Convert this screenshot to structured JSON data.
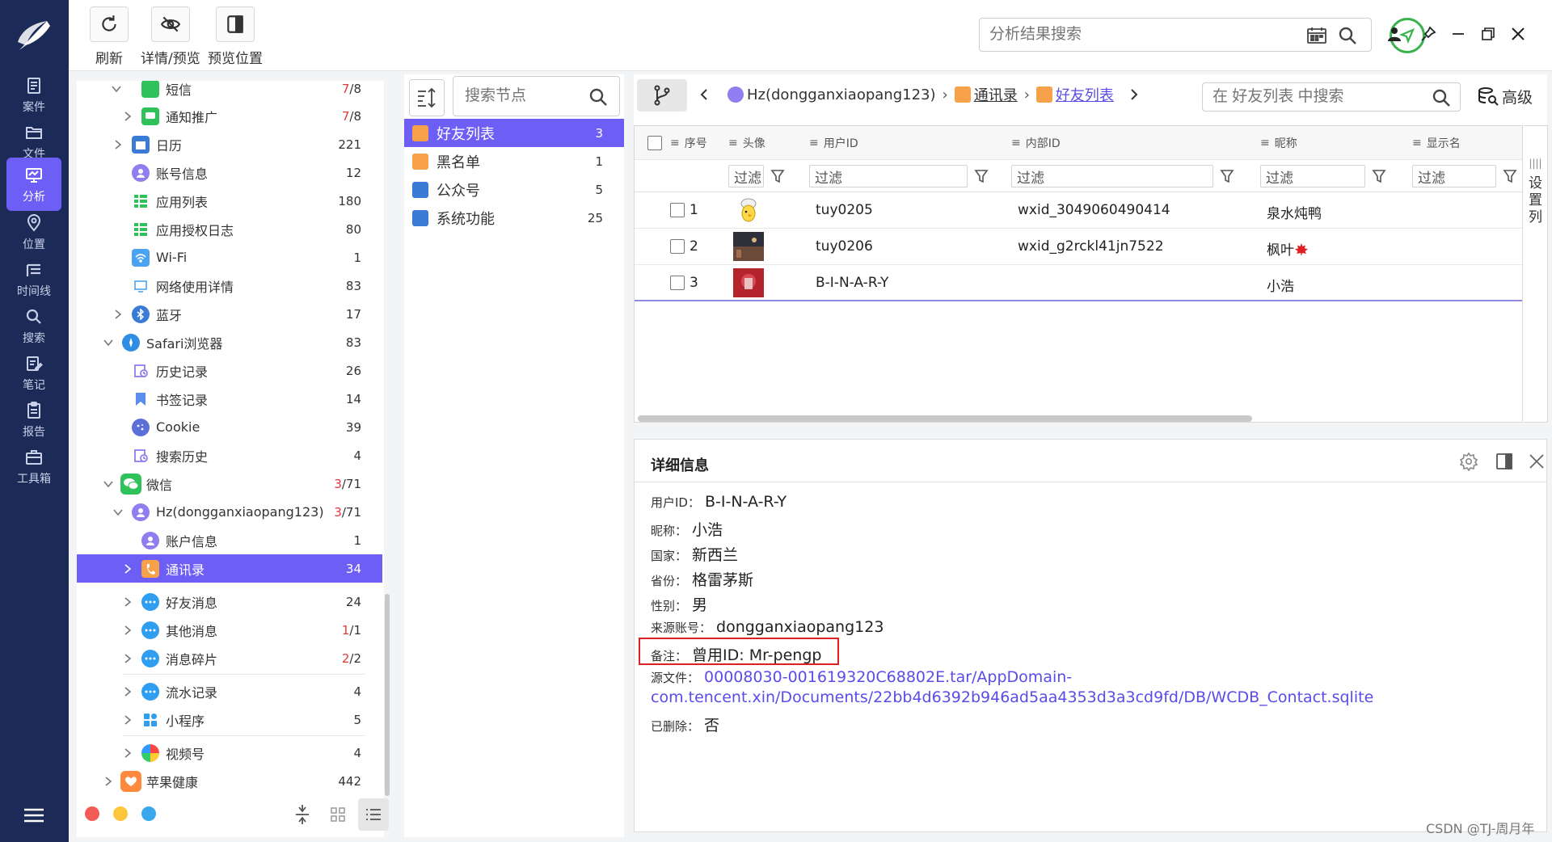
{
  "rail": {
    "items": [
      {
        "label": "案件",
        "icon": "case-icon"
      },
      {
        "label": "文件",
        "icon": "folder-icon"
      },
      {
        "label": "分析",
        "icon": "analysis-icon",
        "active": true
      },
      {
        "label": "位置",
        "icon": "location-icon"
      },
      {
        "label": "时间线",
        "icon": "timeline-icon"
      },
      {
        "label": "搜索",
        "icon": "search-icon"
      },
      {
        "label": "笔记",
        "icon": "note-icon"
      },
      {
        "label": "报告",
        "icon": "report-icon"
      },
      {
        "label": "工具箱",
        "icon": "toolbox-icon"
      }
    ]
  },
  "toolbar": {
    "refresh": "刷新",
    "detail_preview": "详情/预览",
    "preview_position": "预览位置",
    "search_placeholder": "分析结果搜索"
  },
  "tree": {
    "rows": [
      {
        "label": "短信",
        "count_red": "7",
        "count": "/8"
      },
      {
        "label": "通知推广",
        "count_red": "7",
        "count": "/8"
      },
      {
        "label": "日历",
        "count": "221"
      },
      {
        "label": "账号信息",
        "count": "12"
      },
      {
        "label": "应用列表",
        "count": "180"
      },
      {
        "label": "应用授权日志",
        "count": "80"
      },
      {
        "label": "Wi-Fi",
        "count": "1"
      },
      {
        "label": "网络使用详情",
        "count": "83"
      },
      {
        "label": "蓝牙",
        "count": "17"
      },
      {
        "label": "Safari浏览器",
        "count": "83"
      },
      {
        "label": "历史记录",
        "count": "26"
      },
      {
        "label": "书签记录",
        "count": "14"
      },
      {
        "label": "Cookie",
        "count": "39"
      },
      {
        "label": "搜索历史",
        "count": "4"
      },
      {
        "label": "微信",
        "count_red": "3",
        "count": "/71"
      },
      {
        "label": "Hz(dongganxiaopang123)",
        "count_red": "3",
        "count": "/71"
      },
      {
        "label": "账户信息",
        "count": "1"
      },
      {
        "label": "通讯录",
        "count": "34"
      },
      {
        "label": "好友消息",
        "count": "24"
      },
      {
        "label": "其他消息",
        "count_red": "1",
        "count": "/1"
      },
      {
        "label": "消息碎片",
        "count_red": "2",
        "count": "/2"
      },
      {
        "label": "流水记录",
        "count": "4"
      },
      {
        "label": "小程序",
        "count": "5"
      },
      {
        "label": "视频号",
        "count": "4"
      },
      {
        "label": "苹果健康",
        "count": "442"
      }
    ]
  },
  "nodes": {
    "search_placeholder": "搜索节点",
    "items": [
      {
        "label": "好友列表",
        "count": "3"
      },
      {
        "label": "黑名单",
        "count": "1"
      },
      {
        "label": "公众号",
        "count": "5"
      },
      {
        "label": "系统功能",
        "count": "25"
      }
    ]
  },
  "breadcrumb": {
    "account": "Hz(dongganxiaopang123)",
    "contacts": "通讯录",
    "friends": "好友列表",
    "search_placeholder": "在 好友列表 中搜索",
    "advanced": "高级"
  },
  "grid": {
    "columns": [
      "序号",
      "头像",
      "用户ID",
      "内部ID",
      "昵称",
      "显示名"
    ],
    "filter_label": "过滤",
    "rows": [
      {
        "index": "1",
        "user_id": "tuy0205",
        "internal_id": "wxid_3049060490414",
        "nickname": "泉水炖鸭"
      },
      {
        "index": "2",
        "user_id": "tuy0206",
        "internal_id": "wxid_g2rckl41jn7522",
        "nickname": "枫叶"
      },
      {
        "index": "3",
        "user_id": "B-I-N-A-R-Y",
        "internal_id": "",
        "nickname": "小浩"
      }
    ],
    "settings_col": "设置列"
  },
  "detail": {
    "title": "详细信息",
    "fields": [
      {
        "key": "用户ID：",
        "value": "B-I-N-A-R-Y"
      },
      {
        "key": "昵称：",
        "value": "小浩"
      },
      {
        "key": "国家：",
        "value": "新西兰"
      },
      {
        "key": "省份：",
        "value": "格雷茅斯"
      },
      {
        "key": "性别：",
        "value": "男"
      },
      {
        "key": "来源账号：",
        "value": "dongganxiaopang123"
      },
      {
        "key": "备注：",
        "value": "曾用ID: Mr-pengp"
      },
      {
        "key": "源文件：",
        "value": "00008030-001619320C68802E.tar/AppDomain-"
      },
      {
        "key": "",
        "value": "com.tencent.xin/Documents/22bb4d6392b946ad5aa4353d3a3cd9fd/DB/WCDB_Contact.sqlite"
      },
      {
        "key": "已删除：",
        "value": "否"
      }
    ]
  },
  "watermark": "CSDN @TJ-周月年",
  "colors": {
    "accent": "#6d5ef5",
    "rail": "#1c2a57",
    "link": "#5b4be8",
    "highlight_box": "#e02020"
  }
}
